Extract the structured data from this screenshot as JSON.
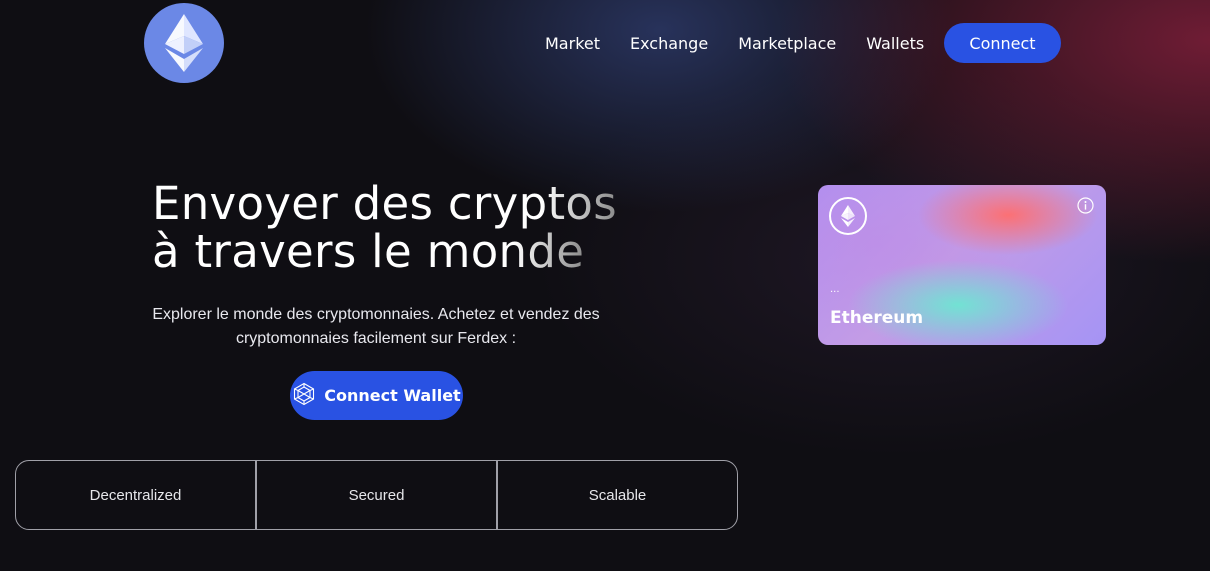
{
  "header": {
    "logo_icon": "ethereum-logo-icon",
    "nav": {
      "items": [
        {
          "label": "Market"
        },
        {
          "label": "Exchange"
        },
        {
          "label": "Marketplace"
        },
        {
          "label": "Wallets"
        }
      ]
    },
    "connect_label": "Connect"
  },
  "hero": {
    "title_plain_1": "Envoyer des ",
    "title_grad_1": "cryptos",
    "title_plain_2": "à travers le ",
    "title_grad_2": "monde",
    "subtitle": "Explorer le monde des cryptomonnaies. Achetez et vendez des cryptomonnaies facilement sur Ferdex :",
    "wallet_button_label": "Connect Wallet",
    "wallet_button_icon": "wallet-hexagon-icon"
  },
  "features": [
    {
      "label": "Decentralized"
    },
    {
      "label": "Secured"
    },
    {
      "label": "Scalable"
    }
  ],
  "card": {
    "icon": "ethereum-icon",
    "info_icon": "info-icon",
    "address": "...",
    "name": "Ethereum"
  },
  "colors": {
    "background": "#0f0e13",
    "accent_blue": "#2952e3",
    "logo_circle": "#6b88e6",
    "card_purple": "#b18ff0"
  }
}
